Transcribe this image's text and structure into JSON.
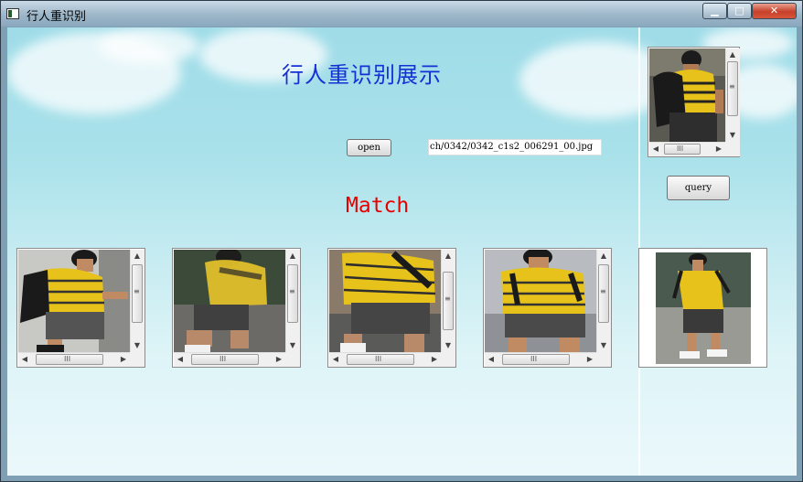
{
  "window": {
    "title": "行人重识别",
    "controls": {
      "minimize": "▁",
      "maximize": "□",
      "close": "✕"
    }
  },
  "main": {
    "heading": "行人重识别展示",
    "open_label": "open",
    "image_path": "ch/0342/0342_c1s2_006291_00.jpg",
    "query_label": "query",
    "match_label": "Match"
  },
  "scroll_glyphs": {
    "up": "▲",
    "down": "▼",
    "left": "◀",
    "right": "▶",
    "grip_v": "≡",
    "grip_h": "III"
  },
  "colors": {
    "heading": "#1530d6",
    "match": "#e60000",
    "shirt": "#e6c21a"
  }
}
